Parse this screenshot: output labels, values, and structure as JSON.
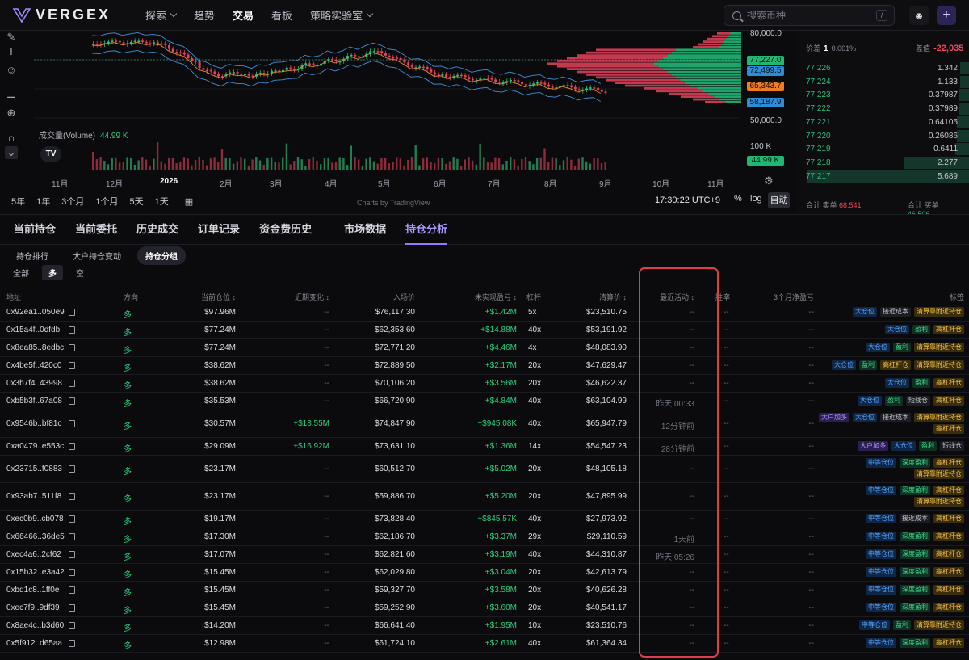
{
  "nav": {
    "brand": "VERGEX",
    "menu": [
      {
        "label": "探索",
        "dropdown": true
      },
      {
        "label": "趋势",
        "dropdown": false
      },
      {
        "label": "交易",
        "dropdown": false,
        "active": true
      },
      {
        "label": "看板",
        "dropdown": false
      },
      {
        "label": "策略实验室",
        "dropdown": true
      }
    ],
    "search_placeholder": "搜索币种",
    "search_shortcut": "/",
    "accent": "#8f7bff"
  },
  "chart": {
    "volume_label": "成交量(Volume)",
    "volume_value": "44.99 K",
    "x_labels": [
      "11月",
      "12月",
      "2026",
      "2月",
      "3月",
      "4月",
      "5月",
      "6月",
      "7月",
      "8月",
      "9月",
      "10月",
      "11月"
    ],
    "price_axis": [
      "80,000.0",
      "70,000.0",
      "60,000.0",
      "50,000.0"
    ],
    "price_tags": [
      {
        "value": "77,227.0",
        "color": "#1fb873"
      },
      {
        "value": "72,499.5",
        "color": "#2d8bd8"
      },
      {
        "value": "65,343.7",
        "color": "#ef7b22"
      },
      {
        "value": "58,187.9",
        "color": "#2d8bd8"
      }
    ],
    "volume_axis": "100 K",
    "volume_tag": "44.99 K",
    "ranges": [
      "5年",
      "1年",
      "3个月",
      "1个月",
      "5天",
      "1天"
    ],
    "credit": "Charts by TradingView",
    "clock": "17:30:22 UTC+9",
    "toggles": [
      "%",
      "log"
    ],
    "auto": "自动"
  },
  "book": {
    "spread_label": "价差",
    "spread_value": "1",
    "spread_pct": "0.001%",
    "diff_label": "差值",
    "diff_value": "-22,035",
    "rows": [
      {
        "price": "77,226",
        "qty": "1.342",
        "depth": 0.05
      },
      {
        "price": "77,224",
        "qty": "1.133",
        "depth": 0.05
      },
      {
        "price": "77,223",
        "qty": "0.37987",
        "depth": 0.06
      },
      {
        "price": "77,222",
        "qty": "0.37989",
        "depth": 0.06
      },
      {
        "price": "77,221",
        "qty": "0.64105",
        "depth": 0.07
      },
      {
        "price": "77,220",
        "qty": "0.26086",
        "depth": 0.07
      },
      {
        "price": "77,219",
        "qty": "0.6411",
        "depth": 0.08
      },
      {
        "price": "77,218",
        "qty": "2.277",
        "depth": 0.38
      },
      {
        "price": "77,217",
        "qty": "5.689",
        "depth": 0.94
      }
    ],
    "total_sell_label": "合计 卖单",
    "total_sell": "68.541",
    "total_buy_label": "合计 买单",
    "total_buy": "46.506"
  },
  "tabs": [
    {
      "label": "当前持仓"
    },
    {
      "label": "当前委托"
    },
    {
      "label": "历史成交"
    },
    {
      "label": "订单记录"
    },
    {
      "label": "资金费历史"
    },
    {
      "label": "市场数据",
      "gap": true
    },
    {
      "label": "持仓分析",
      "active": true
    }
  ],
  "subtabs": [
    {
      "label": "持仓排行"
    },
    {
      "label": "大户持仓变动"
    },
    {
      "label": "持仓分组",
      "active": true
    }
  ],
  "direction_tabs": [
    {
      "label": "全部"
    },
    {
      "label": "多",
      "active": true
    },
    {
      "label": "空"
    }
  ],
  "table": {
    "headers": [
      "地址",
      "方向",
      "当前仓位 ↕",
      "近期变化 ↕",
      "入场价",
      "未实现盈亏 ↕",
      "杠杆",
      "清算价 ↕",
      "最近活动 ↕",
      "胜率",
      "3个月净盈亏",
      "标签"
    ],
    "rows": [
      {
        "address": "0x92ea1..050e9",
        "dir": "多",
        "position": "$97.96M",
        "change": "--",
        "entry": "$76,117.30",
        "pnl": "+$1.42M",
        "lev": "5x",
        "liq": "$23,510.75",
        "activity": "--",
        "winrate": "--",
        "net3m": "--",
        "tags": [
          [
            {
              "t": "大仓位",
              "c": "blue"
            },
            {
              "t": "接近成本",
              "c": "gray"
            },
            {
              "t": "清算靠附近持仓",
              "c": "yellow"
            }
          ]
        ]
      },
      {
        "address": "0x15a4f..0dfdb",
        "dir": "多",
        "position": "$77.24M",
        "change": "--",
        "entry": "$62,353.60",
        "pnl": "+$14.88M",
        "lev": "40x",
        "liq": "$53,191.92",
        "activity": "--",
        "winrate": "--",
        "net3m": "--",
        "tags": [
          [
            {
              "t": "大仓位",
              "c": "blue"
            },
            {
              "t": "盈利",
              "c": "green"
            },
            {
              "t": "高杠杆仓",
              "c": "yellow"
            }
          ]
        ]
      },
      {
        "address": "0x8ea85..8edbc",
        "dir": "多",
        "position": "$77.24M",
        "change": "--",
        "entry": "$72,771.20",
        "pnl": "+$4.46M",
        "lev": "4x",
        "liq": "$48,083.90",
        "activity": "--",
        "winrate": "--",
        "net3m": "--",
        "tags": [
          [
            {
              "t": "大仓位",
              "c": "blue"
            },
            {
              "t": "盈利",
              "c": "green"
            },
            {
              "t": "清算靠附近持仓",
              "c": "yellow"
            }
          ]
        ]
      },
      {
        "address": "0x4be5f..420c0",
        "dir": "多",
        "position": "$38.62M",
        "change": "--",
        "entry": "$72,889.50",
        "pnl": "+$2.17M",
        "lev": "20x",
        "liq": "$47,629.47",
        "activity": "--",
        "winrate": "--",
        "net3m": "--",
        "tags": [
          [
            {
              "t": "大仓位",
              "c": "blue"
            },
            {
              "t": "盈利",
              "c": "green"
            },
            {
              "t": "高杠杆仓",
              "c": "yellow"
            },
            {
              "t": "清算靠附近持仓",
              "c": "yellow"
            }
          ]
        ]
      },
      {
        "address": "0x3b7f4..43998",
        "dir": "多",
        "position": "$38.62M",
        "change": "--",
        "entry": "$70,106.20",
        "pnl": "+$3.56M",
        "lev": "20x",
        "liq": "$46,622.37",
        "activity": "--",
        "winrate": "--",
        "net3m": "--",
        "tags": [
          [
            {
              "t": "大仓位",
              "c": "blue"
            },
            {
              "t": "盈利",
              "c": "green"
            },
            {
              "t": "高杠杆仓",
              "c": "yellow"
            }
          ]
        ]
      },
      {
        "address": "0xb5b3f..67a08",
        "dir": "多",
        "position": "$35.53M",
        "change": "--",
        "entry": "$66,720.90",
        "pnl": "+$4.84M",
        "lev": "40x",
        "liq": "$63,104.99",
        "activity": "昨天 00:33",
        "winrate": "--",
        "net3m": "--",
        "tags": [
          [
            {
              "t": "大仓位",
              "c": "blue"
            },
            {
              "t": "盈利",
              "c": "green"
            },
            {
              "t": "短线仓",
              "c": "gray"
            },
            {
              "t": "高杠杆仓",
              "c": "yellow"
            }
          ]
        ]
      },
      {
        "address": "0x9546b..bf81c",
        "dir": "多",
        "position": "$30.57M",
        "change": "+$18.55M",
        "entry": "$74,847.90",
        "pnl": "+$945.08K",
        "lev": "40x",
        "liq": "$65,947.79",
        "activity": "12分钟前",
        "winrate": "--",
        "net3m": "--",
        "tags": [
          [
            {
              "t": "大户加多",
              "c": "purple"
            },
            {
              "t": "大仓位",
              "c": "blue"
            },
            {
              "t": "接近成本",
              "c": "gray"
            },
            {
              "t": "清算靠附近持仓",
              "c": "yellow"
            }
          ],
          [
            {
              "t": "高杠杆仓",
              "c": "yellow"
            }
          ]
        ]
      },
      {
        "address": "0xa0479..e553c",
        "dir": "多",
        "position": "$29.09M",
        "change": "+$16.92M",
        "entry": "$73,631.10",
        "pnl": "+$1.36M",
        "lev": "14x",
        "liq": "$54,547.23",
        "activity": "28分钟前",
        "winrate": "--",
        "net3m": "--",
        "tags": [
          [
            {
              "t": "大户加多",
              "c": "purple"
            },
            {
              "t": "大仓位",
              "c": "blue"
            },
            {
              "t": "盈利",
              "c": "green"
            },
            {
              "t": "短线仓",
              "c": "gray"
            }
          ]
        ]
      },
      {
        "address": "0x23715..f0883",
        "dir": "多",
        "position": "$23.17M",
        "change": "--",
        "entry": "$60,512.70",
        "pnl": "+$5.02M",
        "lev": "20x",
        "liq": "$48,105.18",
        "activity": "--",
        "winrate": "--",
        "net3m": "--",
        "tags": [
          [
            {
              "t": "中等仓位",
              "c": "blue"
            },
            {
              "t": "深度盈利",
              "c": "green"
            },
            {
              "t": "高杠杆仓",
              "c": "yellow"
            }
          ],
          [
            {
              "t": "清算靠附近持仓",
              "c": "yellow"
            }
          ]
        ]
      },
      {
        "address": "0x93ab7..511f8",
        "dir": "多",
        "position": "$23.17M",
        "change": "--",
        "entry": "$59,886.70",
        "pnl": "+$5.20M",
        "lev": "20x",
        "liq": "$47,895.99",
        "activity": "--",
        "winrate": "--",
        "net3m": "--",
        "tags": [
          [
            {
              "t": "中等仓位",
              "c": "blue"
            },
            {
              "t": "深度盈利",
              "c": "green"
            },
            {
              "t": "高杠杆仓",
              "c": "yellow"
            }
          ],
          [
            {
              "t": "清算靠附近持仓",
              "c": "yellow"
            }
          ]
        ]
      },
      {
        "address": "0xec0b9..cb078",
        "dir": "多",
        "position": "$19.17M",
        "change": "--",
        "entry": "$73,828.40",
        "pnl": "+$845.57K",
        "lev": "40x",
        "liq": "$27,973.92",
        "activity": "--",
        "winrate": "--",
        "net3m": "--",
        "tags": [
          [
            {
              "t": "中等仓位",
              "c": "blue"
            },
            {
              "t": "接近成本",
              "c": "gray"
            },
            {
              "t": "高杠杆仓",
              "c": "yellow"
            }
          ]
        ]
      },
      {
        "address": "0x66466..36de5",
        "dir": "多",
        "position": "$17.30M",
        "change": "--",
        "entry": "$62,186.70",
        "pnl": "+$3.37M",
        "lev": "29x",
        "liq": "$29,110.59",
        "activity": "1天前",
        "winrate": "--",
        "net3m": "--",
        "tags": [
          [
            {
              "t": "中等仓位",
              "c": "blue"
            },
            {
              "t": "深度盈利",
              "c": "green"
            },
            {
              "t": "高杠杆仓",
              "c": "yellow"
            }
          ]
        ]
      },
      {
        "address": "0xec4a6..2cf62",
        "dir": "多",
        "position": "$17.07M",
        "change": "--",
        "entry": "$62,821.60",
        "pnl": "+$3.19M",
        "lev": "40x",
        "liq": "$44,310.87",
        "activity": "昨天 05:26",
        "winrate": "--",
        "net3m": "--",
        "tags": [
          [
            {
              "t": "中等仓位",
              "c": "blue"
            },
            {
              "t": "深度盈利",
              "c": "green"
            },
            {
              "t": "高杠杆仓",
              "c": "yellow"
            }
          ]
        ]
      },
      {
        "address": "0x15b32..e3a42",
        "dir": "多",
        "position": "$15.45M",
        "change": "--",
        "entry": "$62,029.80",
        "pnl": "+$3.04M",
        "lev": "20x",
        "liq": "$42,613.79",
        "activity": "--",
        "winrate": "--",
        "net3m": "--",
        "tags": [
          [
            {
              "t": "中等仓位",
              "c": "blue"
            },
            {
              "t": "深度盈利",
              "c": "green"
            },
            {
              "t": "高杠杆仓",
              "c": "yellow"
            }
          ]
        ]
      },
      {
        "address": "0xbd1c8..1ff0e",
        "dir": "多",
        "position": "$15.45M",
        "change": "--",
        "entry": "$59,327.70",
        "pnl": "+$3.58M",
        "lev": "20x",
        "liq": "$40,626.28",
        "activity": "--",
        "winrate": "--",
        "net3m": "--",
        "tags": [
          [
            {
              "t": "中等仓位",
              "c": "blue"
            },
            {
              "t": "深度盈利",
              "c": "green"
            },
            {
              "t": "高杠杆仓",
              "c": "yellow"
            }
          ]
        ]
      },
      {
        "address": "0xec7f9..9df39",
        "dir": "多",
        "position": "$15.45M",
        "change": "--",
        "entry": "$59,252.90",
        "pnl": "+$3.60M",
        "lev": "20x",
        "liq": "$40,541.17",
        "activity": "--",
        "winrate": "--",
        "net3m": "--",
        "tags": [
          [
            {
              "t": "中等仓位",
              "c": "blue"
            },
            {
              "t": "深度盈利",
              "c": "green"
            },
            {
              "t": "高杠杆仓",
              "c": "yellow"
            }
          ]
        ]
      },
      {
        "address": "0x8ae4c..b3d60",
        "dir": "多",
        "position": "$14.20M",
        "change": "--",
        "entry": "$66,641.40",
        "pnl": "+$1.95M",
        "lev": "10x",
        "liq": "$23,510.76",
        "activity": "--",
        "winrate": "--",
        "net3m": "--",
        "tags": [
          [
            {
              "t": "中等仓位",
              "c": "blue"
            },
            {
              "t": "盈利",
              "c": "green"
            },
            {
              "t": "清算靠附近持仓",
              "c": "yellow"
            }
          ]
        ]
      },
      {
        "address": "0x5f912..d65aa",
        "dir": "多",
        "position": "$12.98M",
        "change": "--",
        "entry": "$61,724.10",
        "pnl": "+$2.61M",
        "lev": "40x",
        "liq": "$61,364.34",
        "activity": "--",
        "winrate": "--",
        "net3m": "--",
        "tags": [
          [
            {
              "t": "中等仓位",
              "c": "blue"
            },
            {
              "t": "深度盈利",
              "c": "green"
            },
            {
              "t": "高杠杆仓",
              "c": "yellow"
            }
          ]
        ]
      }
    ]
  },
  "icons": [
    "logo-v-icon",
    "chevron-down-icon",
    "search-icon",
    "user-add-icon",
    "plus-icon",
    "copy-icon",
    "settings-icon",
    "calendar-icon",
    "pencil-icon",
    "text-icon",
    "emoji-icon",
    "ruler-icon",
    "zoom-icon",
    "magnet-icon"
  ]
}
